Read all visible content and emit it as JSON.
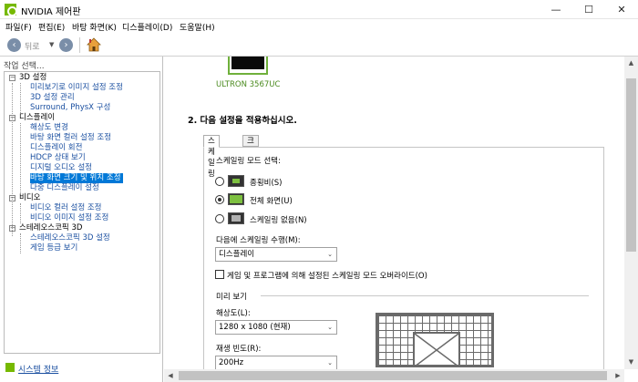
{
  "window": {
    "title": "NVIDIA 제어판",
    "min": "—",
    "max": "☐",
    "close": "✕"
  },
  "menu": [
    "파일(F)",
    "편집(E)",
    "바탕 화면(K)",
    "디스플레이(D)",
    "도움말(H)"
  ],
  "toolbar": {
    "back_label": "뒤로"
  },
  "left": {
    "header": "작업 선택...",
    "tree": [
      {
        "text": "3D 설정",
        "type": "cat"
      },
      {
        "text": "미리보기로 이미지 설정 조정",
        "type": "link"
      },
      {
        "text": "3D 설정 관리",
        "type": "link"
      },
      {
        "text": "Surround, PhysX 구성",
        "type": "link"
      },
      {
        "text": "디스플레이",
        "type": "cat"
      },
      {
        "text": "해상도 변경",
        "type": "link"
      },
      {
        "text": "바탕 화면 컬러 설정 조정",
        "type": "link"
      },
      {
        "text": "디스플레이 회전",
        "type": "link"
      },
      {
        "text": "HDCP 상태 보기",
        "type": "link"
      },
      {
        "text": "디지털 오디오 설정",
        "type": "link"
      },
      {
        "text": "바탕 화면 크기 및 위치 조정",
        "type": "sel"
      },
      {
        "text": "다중 디스플레이 설정",
        "type": "link"
      },
      {
        "text": "비디오",
        "type": "cat"
      },
      {
        "text": "비디오 컬러 설정 조정",
        "type": "link"
      },
      {
        "text": "비디오 이미지 설정 조정",
        "type": "link"
      },
      {
        "text": "스테레오스코픽 3D",
        "type": "cat"
      },
      {
        "text": "스테레오스코픽 3D 설정",
        "type": "link"
      },
      {
        "text": "게임 등급 보기",
        "type": "link"
      }
    ],
    "system_info": "시스템 정보"
  },
  "right": {
    "monitor_label": "ULTRON 3567UC",
    "section_title": "2. 다음 설정을 적용하십시오.",
    "tabs": [
      "스케일링",
      "크기"
    ],
    "scaling_mode_label": "스케일링 모드 선택:",
    "modes": [
      "종횡비(S)",
      "전체 화면(U)",
      "스케일링 없음(N)"
    ],
    "perform_label": "다음에 스케일링 수행(M):",
    "perform_value": "디스플레이",
    "override_label": "게임 및 프로그램에 의해 설정된 스케일링 모드 오버라이드(O)",
    "preview_label": "미리 보기",
    "resolution_label": "해상도(L):",
    "resolution_value": "1280 x 1080 (현재)",
    "refresh_label": "재생 빈도(R):",
    "refresh_value": "200Hz"
  }
}
